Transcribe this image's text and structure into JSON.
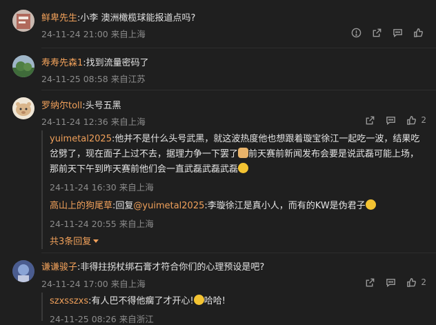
{
  "comments": [
    {
      "username": "鲜卑先生",
      "text": ":小李 澳洲橄榄球能报道点吗?",
      "date": "24-11-24 21:00",
      "location": "来自上海"
    },
    {
      "username": "寿寿先森1",
      "text": ":找到流量密码了",
      "date": "24-11-25 08:58",
      "location": "来自江苏"
    },
    {
      "username": "罗纳尔toll",
      "text": ":头号五黑",
      "date": "24-11-24 12:36",
      "location": "来自上海",
      "likes": "2",
      "replies": [
        {
          "username": "yuimetal2025",
          "text_part1": ":他并不是什么头号武黑，就这波热度他也想跟着璇宝徐江一起吃一波，结果吃",
          "text_part2": "岔劈了，现在面子上过不去，据理力争一下罢了",
          "text_part3": "前天赛前新闻发布会要是说武磊可能上场，",
          "text_part4": "那前天下午到昨天赛前他们会一直武磊武磊武磊",
          "date": "24-11-24 16:30",
          "location": "来自上海"
        },
        {
          "username": "高山上的狗尾草",
          "reply_word": ":回复",
          "at_user": "@yuimetal2025",
          "text": ":李璇徐江是真小人，而有的KW是伪君子",
          "date": "24-11-24 20:55",
          "location": "来自上海"
        }
      ],
      "more_replies": "共3条回复"
    },
    {
      "username": "谦谦骏子",
      "text": ":非得拄拐杖绑石膏才符合你们的心理预设是吧?",
      "date": "24-11-24 17:00",
      "location": "来自上海",
      "likes": "2",
      "replies": [
        {
          "username": "szxsszxs",
          "text": ":有人巴不得他瘸了才开心!",
          "text_tail": "哈哈!",
          "date": "24-11-25 08:26",
          "location": "来自浙江"
        }
      ]
    }
  ]
}
